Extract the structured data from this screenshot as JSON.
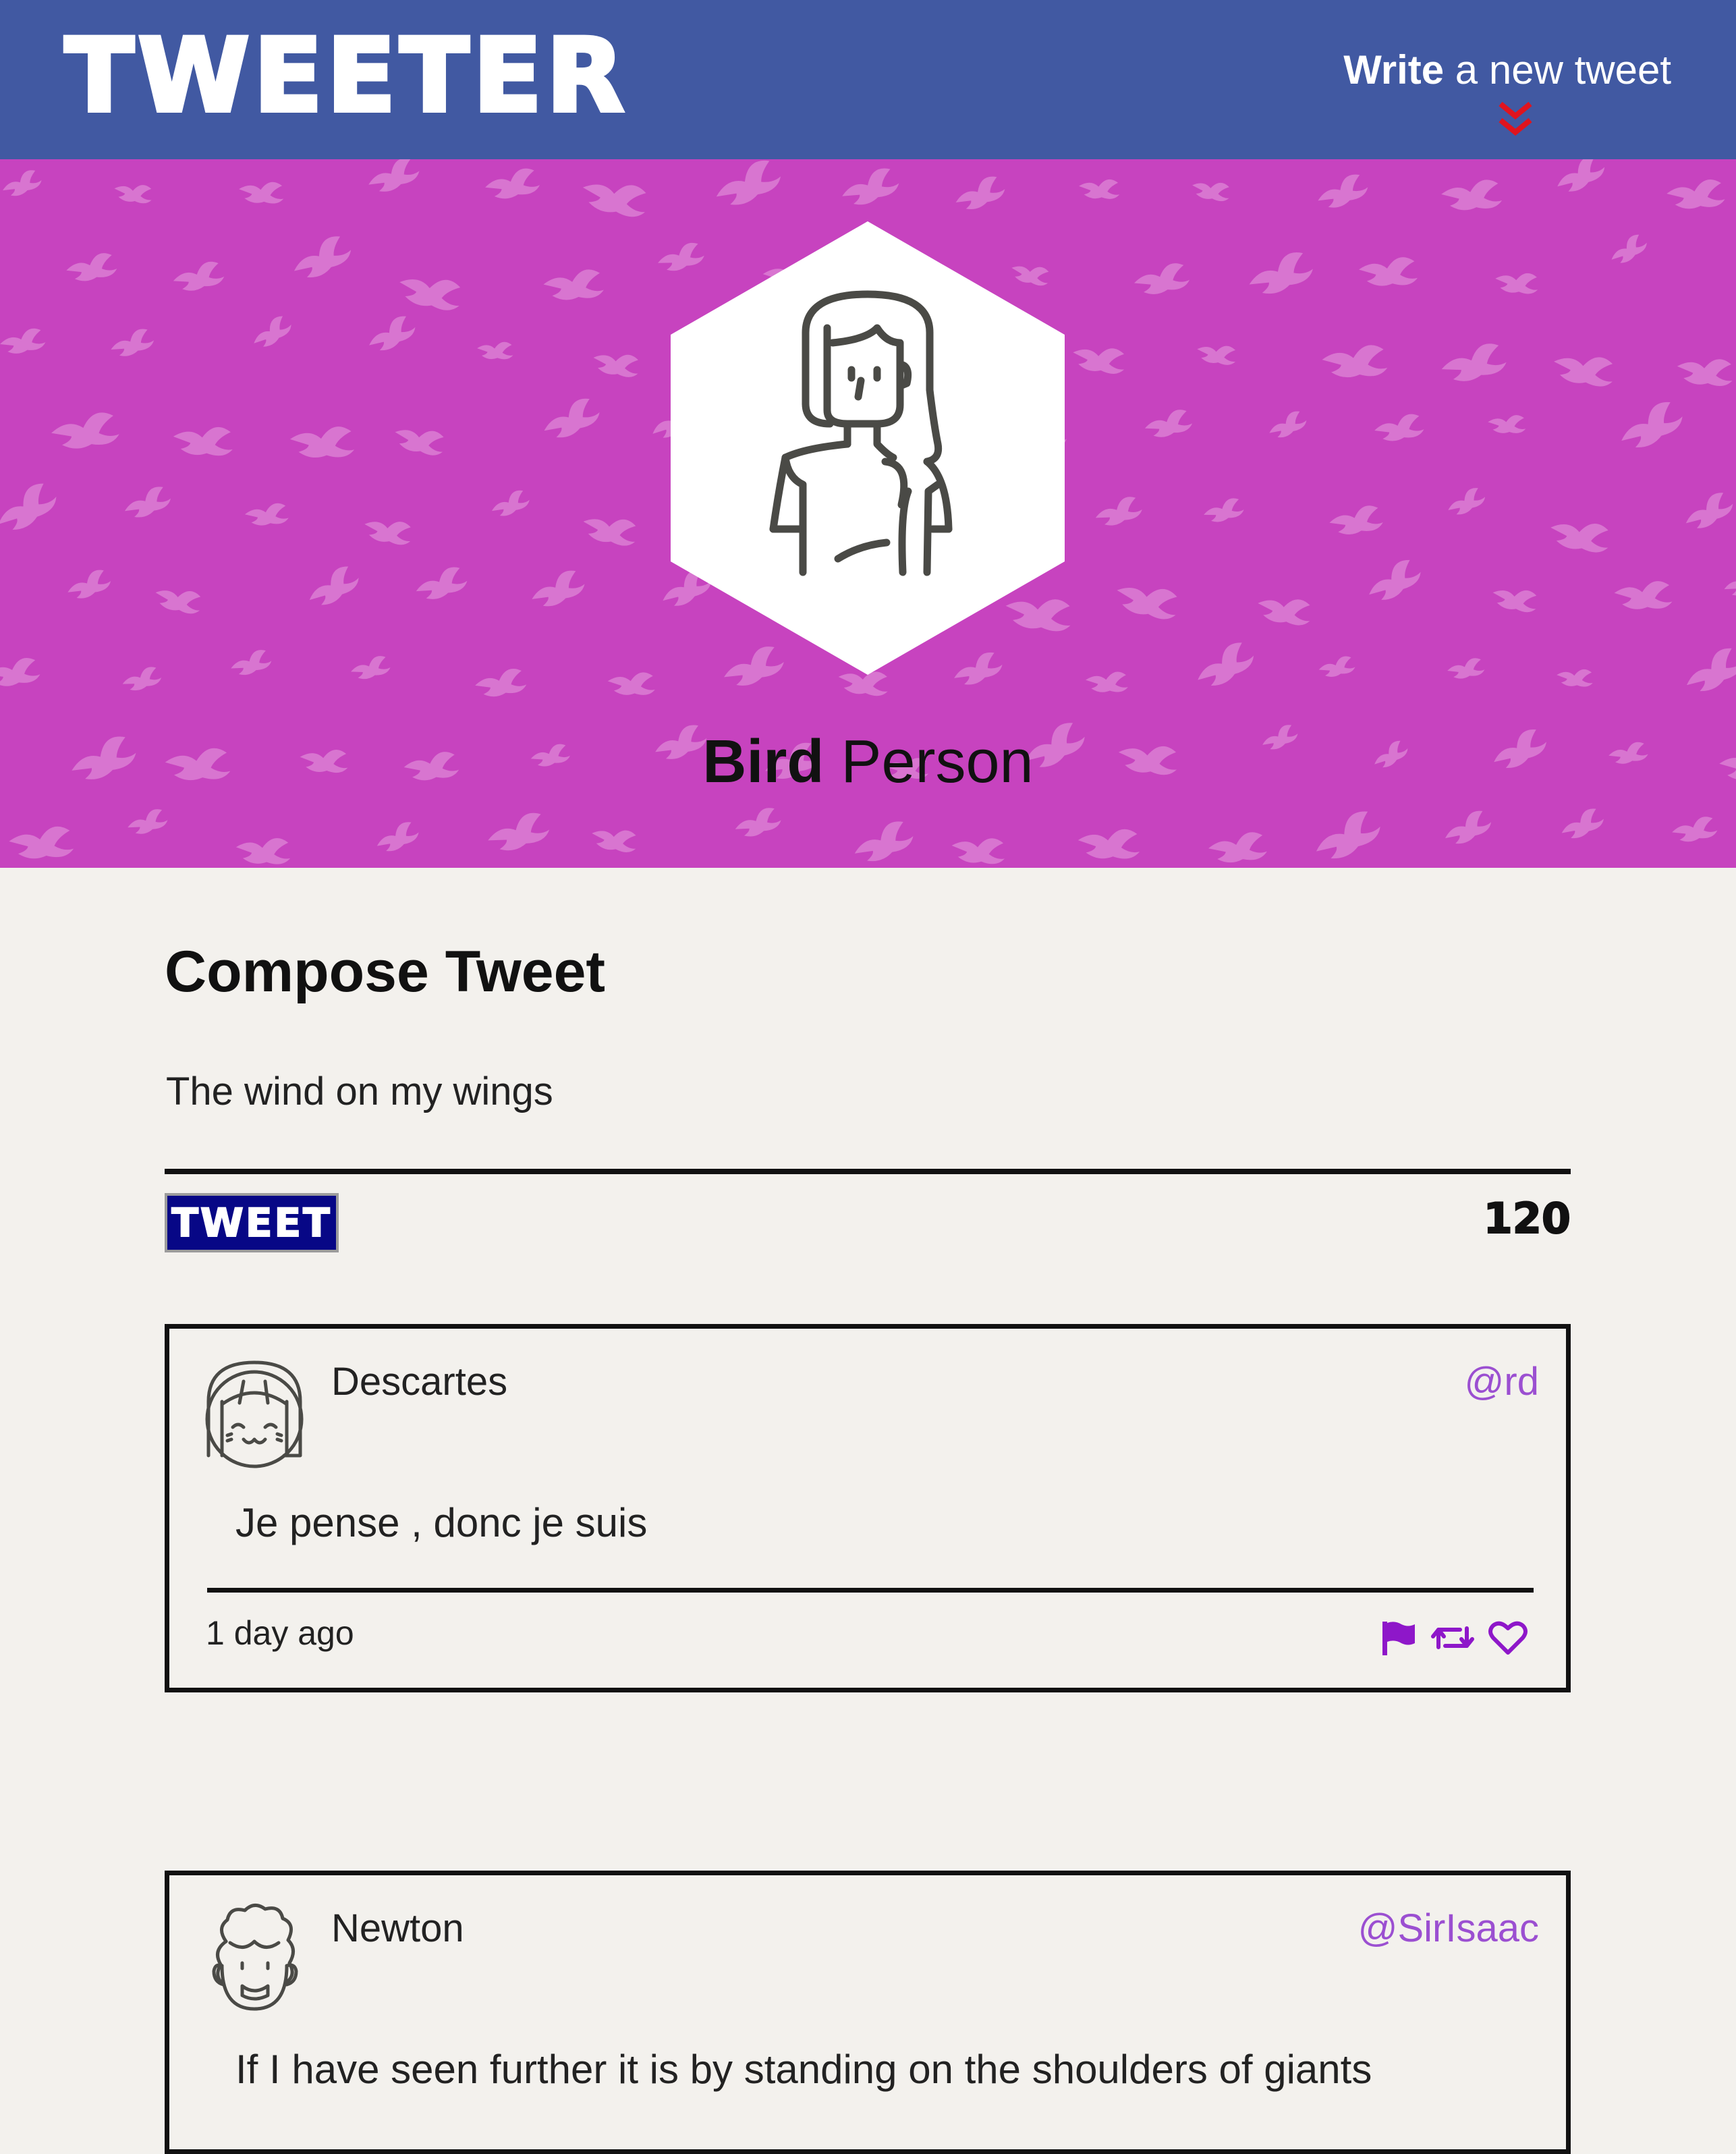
{
  "nav": {
    "brand": "TWEETER",
    "write_bold": "Write",
    "write_rest": " a new tweet"
  },
  "profile": {
    "first_name": "Bird",
    "last_name": " Person"
  },
  "compose": {
    "title": "Compose Tweet",
    "input_value": "The wind on my wings",
    "button_label": "TWEET",
    "counter": "120"
  },
  "tweets": [
    {
      "name": "Descartes",
      "handle": "@rd",
      "text": "Je pense , donc je suis",
      "time": "1 day ago"
    },
    {
      "name": "Newton",
      "handle": "@SirIsaac",
      "text": "If I have seen further it is by standing on the shoulders of giants"
    }
  ],
  "colors": {
    "nav_bg": "#4159a2",
    "header_bg": "#c743bf",
    "page_bg": "#f3f1ed",
    "tweet_button_bg": "#070786",
    "accent_purple": "#9b4fd1",
    "chevron_red": "#e0141e"
  },
  "icons": [
    "chevron-double-down-icon",
    "flag-icon",
    "retweet-icon",
    "heart-icon"
  ]
}
